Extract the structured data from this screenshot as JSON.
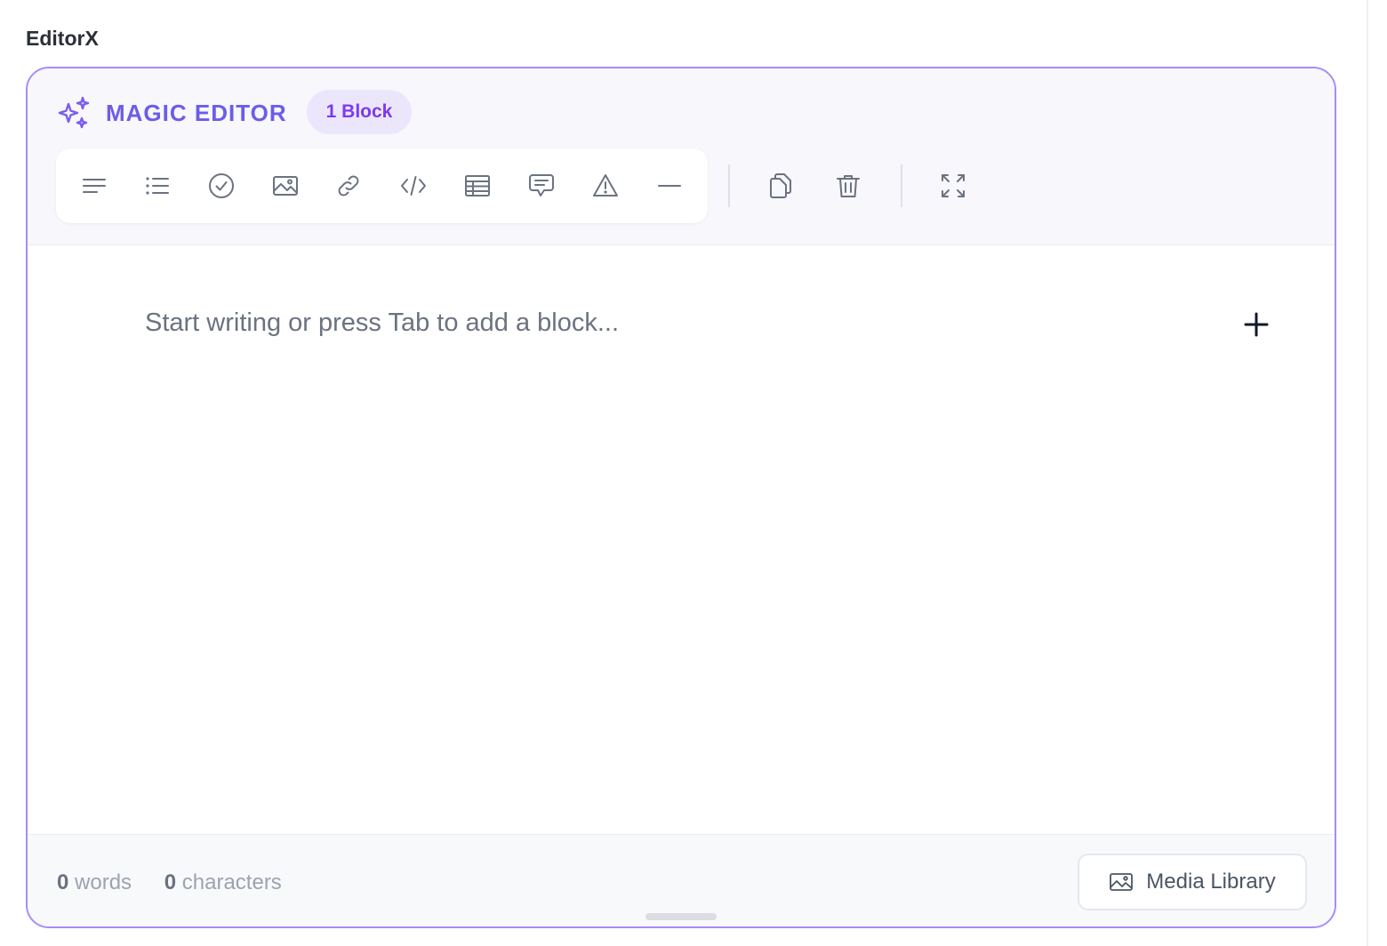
{
  "page": {
    "label": "EditorX"
  },
  "editor": {
    "brand_title": "MAGIC EDITOR",
    "block_badge": "1 Block",
    "toolbar": {
      "items": [
        {
          "icon": "paragraph-icon"
        },
        {
          "icon": "bulleted-list-icon"
        },
        {
          "icon": "checklist-icon"
        },
        {
          "icon": "image-icon"
        },
        {
          "icon": "link-icon"
        },
        {
          "icon": "code-icon"
        },
        {
          "icon": "table-icon"
        },
        {
          "icon": "comment-icon"
        },
        {
          "icon": "warning-icon"
        },
        {
          "icon": "divider-icon"
        }
      ],
      "actions": [
        {
          "icon": "copy-icon"
        },
        {
          "icon": "trash-icon"
        },
        {
          "icon": "expand-icon"
        }
      ]
    },
    "placeholder": "Start writing or press Tab to add a block...",
    "footer": {
      "word_count": "0",
      "word_label": "words",
      "char_count": "0",
      "char_label": "characters",
      "media_button": "Media Library"
    }
  },
  "colors": {
    "accent": "#6d5ce8",
    "accent_border": "#a78bfa",
    "badge_bg": "#ece6fd",
    "badge_text": "#7c3aed",
    "icon": "#6b7280"
  }
}
